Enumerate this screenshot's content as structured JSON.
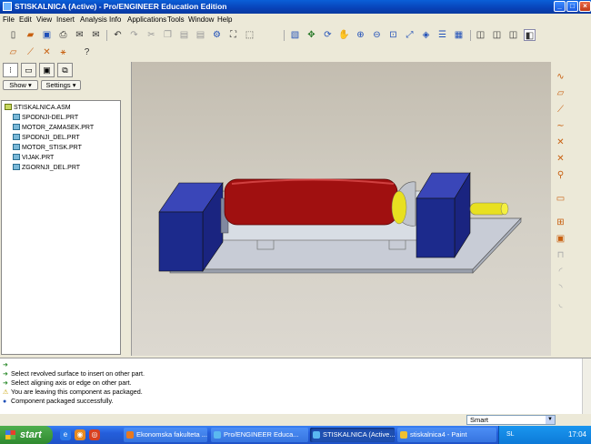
{
  "window": {
    "title": "STISKALNICA (Active) - Pro/ENGINEER Education Edition",
    "controls": [
      "minimize",
      "maximize",
      "close"
    ]
  },
  "menu": [
    "File",
    "Edit",
    "View",
    "Insert",
    "Analysis",
    "Info",
    "Applications",
    "Tools",
    "Window",
    "Help"
  ],
  "left_panel": {
    "show_label": "Show",
    "settings_label": "Settings",
    "tree": {
      "root": "STISKALNICA.ASM",
      "items": [
        "SPODNJI-DEL.PRT",
        "MOTOR_ZAMASEK.PRT",
        "SPODNJI_DEL.PRT",
        "MOTOR_STISK.PRT",
        "VIJAK.PRT",
        "ZGORNJI_DEL.PRT"
      ]
    }
  },
  "messages": [
    {
      "icon": "arrow-icon",
      "text": ""
    },
    {
      "icon": "arrow-icon",
      "text": "Select revolved surface to insert on other part."
    },
    {
      "icon": "arrow-icon",
      "text": "Select aligning axis or edge on other part."
    },
    {
      "icon": "warning-icon",
      "text": "You are leaving this component as packaged."
    },
    {
      "icon": "bullet-icon",
      "text": "Component packaged successfully."
    }
  ],
  "filter": {
    "value": "Smart"
  },
  "taskbar": {
    "start_label": "start",
    "buttons": [
      {
        "label": "Ekonomska fakulteta ...",
        "active": false
      },
      {
        "label": "Pro/ENGINEER Educa...",
        "active": false
      },
      {
        "label": "STISKALNICA (Active...",
        "active": true
      },
      {
        "label": "stiskalnica4 - Paint",
        "active": false
      }
    ],
    "language": "SL",
    "clock": "17:04"
  },
  "colors": {
    "model_blue": "#1c2a8c",
    "model_red": "#a01010",
    "model_yellow": "#e8e020",
    "base_plate": "#c8ccd6",
    "xp_blue": "#245edb"
  }
}
